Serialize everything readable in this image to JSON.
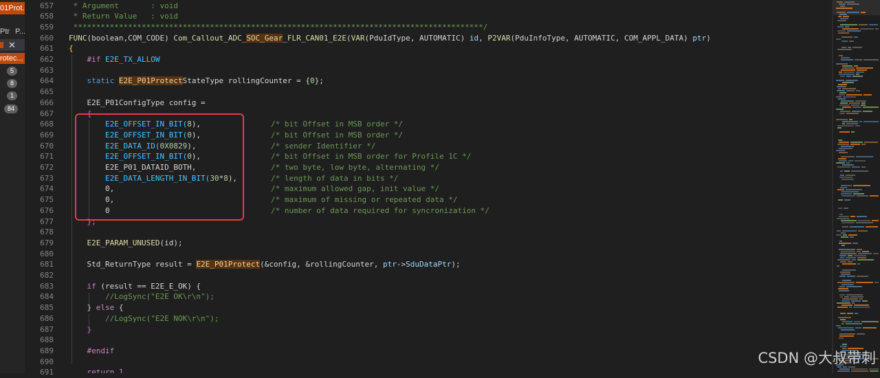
{
  "left_panel": {
    "active_tab": "01Prot...",
    "header_items": [
      "Ptr",
      "P..."
    ],
    "file_row": {
      "close_glyph": "✕"
    },
    "active_item": "rotec...",
    "badges": [
      "5",
      "8",
      "1",
      "84"
    ]
  },
  "editor": {
    "line_numbers": [
      "657",
      "658",
      "659",
      "660",
      "661",
      "662",
      "663",
      "664",
      "665",
      "666",
      "667",
      "668",
      "669",
      "670",
      "671",
      "672",
      "673",
      "674",
      "675",
      "676",
      "677",
      "678",
      "679",
      "680",
      "681",
      "682",
      "683",
      "684",
      "685",
      "686",
      "687",
      "688",
      "689",
      "690",
      "691"
    ],
    "lines": {
      "l657": " * Argument       : void",
      "l658": " * Return Value   : void",
      "l659": " ******************************************************************************************/",
      "l660_a": "FUNC",
      "l660_b": "(boolean,COM_CODE) ",
      "l660_c": "Com_Callout_ADC_",
      "l660_d": "SOC_Gear",
      "l660_e": "_FLR_CAN01_E2E",
      "l660_f": "(",
      "l660_g": "VAR",
      "l660_h": "(PduIdType, AUTOMATIC) ",
      "l660_i": "id",
      "l660_j": ", ",
      "l660_k": "P2VAR",
      "l660_l": "(PduInfoType, AUTOMATIC, COM_APPL_DATA) ",
      "l660_m": "ptr",
      "l660_n": ")",
      "l661": "{",
      "l662_a": "    #if ",
      "l662_b": "E2E_TX_ALLOW",
      "l664_a": "    static ",
      "l664_b": "E2E_P01Protect",
      "l664_c": "StateType rollingCounter = {",
      "l664_d": "0",
      "l664_e": "};",
      "l666": "    E2E_P01ConfigType config =",
      "l667": "    {",
      "l668_a": "        E2E_OFFSET_IN_BIT(",
      "l668_b": "8",
      "l668_c": "),",
      "l668_cm": "/* bit Offset in MSB order */",
      "l669_a": "        E2E_OFFSET_IN_BIT(",
      "l669_b": "0",
      "l669_c": "),",
      "l669_cm": "/* bit Offset in MSB order */",
      "l670_a": "        E2E_DATA_ID(",
      "l670_b": "0X0829",
      "l670_c": "),",
      "l670_cm": "/* sender Identifier */",
      "l671_a": "        E2E_OFFSET_IN_BIT(",
      "l671_b": "0",
      "l671_c": "),",
      "l671_cm": "/* bit Offset in MSB order for Profile 1C */",
      "l672_a": "        E2E_P01_DATAID_BOTH,",
      "l672_cm": "/* two byte, low byte, alternating */",
      "l673_a": "        E2E_DATA_LENGTH_IN_BIT(",
      "l673_b": "30",
      "l673_c": "*",
      "l673_d": "8",
      "l673_e": "),",
      "l673_cm": "/* length of data in bits */",
      "l674_a": "        0,",
      "l674_cm": "/* maximum allowed gap, init value */",
      "l675_a": "        0,",
      "l675_cm": "/* maximum of missing or repeated data */",
      "l676_a": "        0",
      "l676_cm": "/* number of data required for syncronization */",
      "l677": "    };",
      "l679_a": "    E2E_PARAM_UNUSED",
      "l679_b": "(id);",
      "l681_a": "    Std_ReturnType result = ",
      "l681_b": "E2E_P01Protect",
      "l681_c": "(&config, &rollingCounter, ",
      "l681_d": "ptr",
      "l681_e": "->",
      "l681_f": "SduDataPtr",
      "l681_g": ");",
      "l683_a": "    if ",
      "l683_b": "(result == E2E_E_OK) {",
      "l684": "        //LogSync(\"E2E OK\\r\\n\");",
      "l685_a": "    } ",
      "l685_b": "else",
      "l685_c": " {",
      "l686": "        //LogSync(\"E2E NOK\\r\\n\");",
      "l687": "    }",
      "l689": "    #endif",
      "l691": "    return 1"
    }
  },
  "watermark": "CSDN @大叔带刺",
  "colors": {
    "accent": "#c04a0b",
    "highlight_box": "#e04040",
    "background": "#1f1f1f"
  }
}
